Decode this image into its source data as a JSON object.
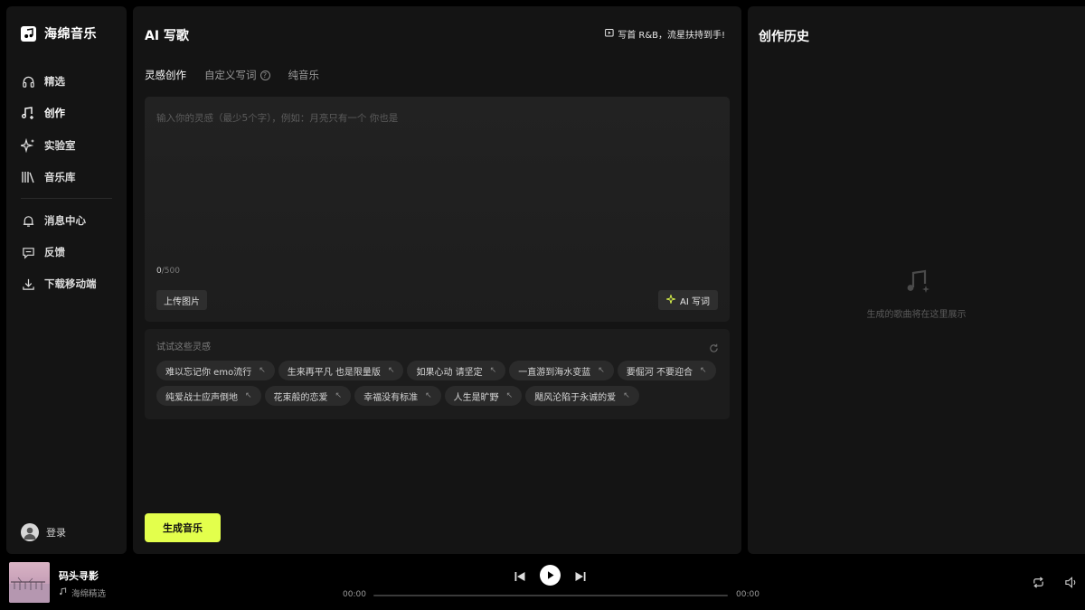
{
  "app": {
    "name": "海绵音乐"
  },
  "sidebar": {
    "items": [
      {
        "label": "精选",
        "icon": "headphones-icon"
      },
      {
        "label": "创作",
        "icon": "music-create-icon",
        "active": true
      },
      {
        "label": "实验室",
        "icon": "sparkle-icon"
      },
      {
        "label": "音乐库",
        "icon": "library-icon"
      },
      {
        "label": "消息中心",
        "icon": "bell-icon"
      },
      {
        "label": "反馈",
        "icon": "feedback-icon"
      },
      {
        "label": "下载移动端",
        "icon": "download-icon"
      }
    ],
    "login_label": "登录"
  },
  "main": {
    "title": "AI 写歌",
    "promo": "写首 R&B，流星扶持到手!",
    "tabs": [
      {
        "label": "灵感创作",
        "active": true
      },
      {
        "label": "自定义写词",
        "has_help": true
      },
      {
        "label": "纯音乐"
      }
    ],
    "editor": {
      "placeholder": "输入你的灵感（最少5个字），例如：月亮只有一个 你也是",
      "value": "",
      "count_current": "0",
      "count_max": "/500",
      "upload_label": "上传图片",
      "ai_lyric_label": "AI 写词"
    },
    "ideas": {
      "title": "试试这些灵感",
      "chips": [
        "难以忘记你 emo流行",
        "生来再平凡 也是限量版",
        "如果心动 请坚定",
        "一直游到海水变蓝",
        "要倔河 不要迎合",
        "纯爱战士应声倒地",
        "花束般的恋爱",
        "幸福没有标准",
        "人生是旷野",
        "飓风沦陷于永诚的爱"
      ]
    },
    "generate_label": "生成音乐"
  },
  "history": {
    "title": "创作历史",
    "empty_text": "生成的歌曲将在这里展示"
  },
  "player": {
    "track_title": "码头寻影",
    "track_artist": "海绵精选",
    "time_current": "00:00",
    "time_total": "00:00",
    "progress": 0
  },
  "colors": {
    "accent": "#e3ff4c",
    "background": "#000000",
    "panel": "#141414"
  }
}
